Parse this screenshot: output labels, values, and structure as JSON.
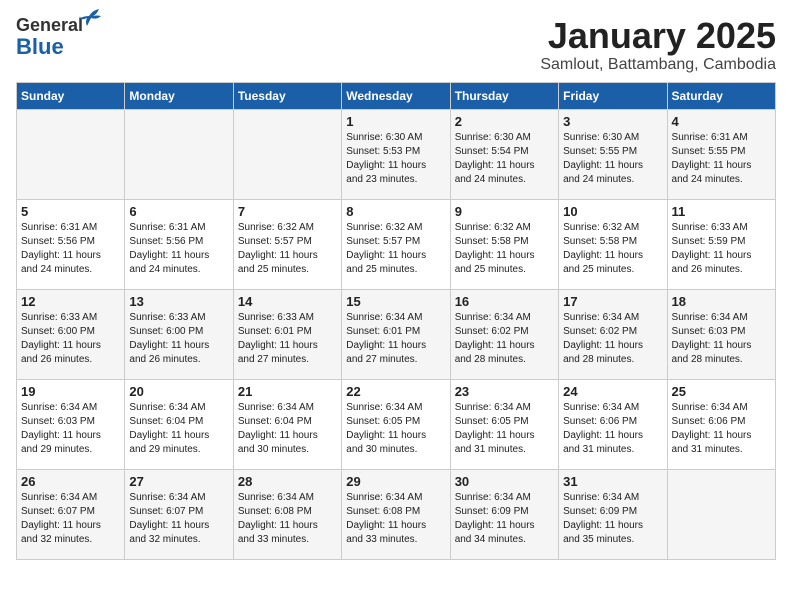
{
  "header": {
    "logo_general": "General",
    "logo_blue": "Blue",
    "title": "January 2025",
    "location": "Samlout, Battambang, Cambodia"
  },
  "weekdays": [
    "Sunday",
    "Monday",
    "Tuesday",
    "Wednesday",
    "Thursday",
    "Friday",
    "Saturday"
  ],
  "weeks": [
    [
      {
        "day": "",
        "info": ""
      },
      {
        "day": "",
        "info": ""
      },
      {
        "day": "",
        "info": ""
      },
      {
        "day": "1",
        "info": "Sunrise: 6:30 AM\nSunset: 5:53 PM\nDaylight: 11 hours\nand 23 minutes."
      },
      {
        "day": "2",
        "info": "Sunrise: 6:30 AM\nSunset: 5:54 PM\nDaylight: 11 hours\nand 24 minutes."
      },
      {
        "day": "3",
        "info": "Sunrise: 6:30 AM\nSunset: 5:55 PM\nDaylight: 11 hours\nand 24 minutes."
      },
      {
        "day": "4",
        "info": "Sunrise: 6:31 AM\nSunset: 5:55 PM\nDaylight: 11 hours\nand 24 minutes."
      }
    ],
    [
      {
        "day": "5",
        "info": "Sunrise: 6:31 AM\nSunset: 5:56 PM\nDaylight: 11 hours\nand 24 minutes."
      },
      {
        "day": "6",
        "info": "Sunrise: 6:31 AM\nSunset: 5:56 PM\nDaylight: 11 hours\nand 24 minutes."
      },
      {
        "day": "7",
        "info": "Sunrise: 6:32 AM\nSunset: 5:57 PM\nDaylight: 11 hours\nand 25 minutes."
      },
      {
        "day": "8",
        "info": "Sunrise: 6:32 AM\nSunset: 5:57 PM\nDaylight: 11 hours\nand 25 minutes."
      },
      {
        "day": "9",
        "info": "Sunrise: 6:32 AM\nSunset: 5:58 PM\nDaylight: 11 hours\nand 25 minutes."
      },
      {
        "day": "10",
        "info": "Sunrise: 6:32 AM\nSunset: 5:58 PM\nDaylight: 11 hours\nand 25 minutes."
      },
      {
        "day": "11",
        "info": "Sunrise: 6:33 AM\nSunset: 5:59 PM\nDaylight: 11 hours\nand 26 minutes."
      }
    ],
    [
      {
        "day": "12",
        "info": "Sunrise: 6:33 AM\nSunset: 6:00 PM\nDaylight: 11 hours\nand 26 minutes."
      },
      {
        "day": "13",
        "info": "Sunrise: 6:33 AM\nSunset: 6:00 PM\nDaylight: 11 hours\nand 26 minutes."
      },
      {
        "day": "14",
        "info": "Sunrise: 6:33 AM\nSunset: 6:01 PM\nDaylight: 11 hours\nand 27 minutes."
      },
      {
        "day": "15",
        "info": "Sunrise: 6:34 AM\nSunset: 6:01 PM\nDaylight: 11 hours\nand 27 minutes."
      },
      {
        "day": "16",
        "info": "Sunrise: 6:34 AM\nSunset: 6:02 PM\nDaylight: 11 hours\nand 28 minutes."
      },
      {
        "day": "17",
        "info": "Sunrise: 6:34 AM\nSunset: 6:02 PM\nDaylight: 11 hours\nand 28 minutes."
      },
      {
        "day": "18",
        "info": "Sunrise: 6:34 AM\nSunset: 6:03 PM\nDaylight: 11 hours\nand 28 minutes."
      }
    ],
    [
      {
        "day": "19",
        "info": "Sunrise: 6:34 AM\nSunset: 6:03 PM\nDaylight: 11 hours\nand 29 minutes."
      },
      {
        "day": "20",
        "info": "Sunrise: 6:34 AM\nSunset: 6:04 PM\nDaylight: 11 hours\nand 29 minutes."
      },
      {
        "day": "21",
        "info": "Sunrise: 6:34 AM\nSunset: 6:04 PM\nDaylight: 11 hours\nand 30 minutes."
      },
      {
        "day": "22",
        "info": "Sunrise: 6:34 AM\nSunset: 6:05 PM\nDaylight: 11 hours\nand 30 minutes."
      },
      {
        "day": "23",
        "info": "Sunrise: 6:34 AM\nSunset: 6:05 PM\nDaylight: 11 hours\nand 31 minutes."
      },
      {
        "day": "24",
        "info": "Sunrise: 6:34 AM\nSunset: 6:06 PM\nDaylight: 11 hours\nand 31 minutes."
      },
      {
        "day": "25",
        "info": "Sunrise: 6:34 AM\nSunset: 6:06 PM\nDaylight: 11 hours\nand 31 minutes."
      }
    ],
    [
      {
        "day": "26",
        "info": "Sunrise: 6:34 AM\nSunset: 6:07 PM\nDaylight: 11 hours\nand 32 minutes."
      },
      {
        "day": "27",
        "info": "Sunrise: 6:34 AM\nSunset: 6:07 PM\nDaylight: 11 hours\nand 32 minutes."
      },
      {
        "day": "28",
        "info": "Sunrise: 6:34 AM\nSunset: 6:08 PM\nDaylight: 11 hours\nand 33 minutes."
      },
      {
        "day": "29",
        "info": "Sunrise: 6:34 AM\nSunset: 6:08 PM\nDaylight: 11 hours\nand 33 minutes."
      },
      {
        "day": "30",
        "info": "Sunrise: 6:34 AM\nSunset: 6:09 PM\nDaylight: 11 hours\nand 34 minutes."
      },
      {
        "day": "31",
        "info": "Sunrise: 6:34 AM\nSunset: 6:09 PM\nDaylight: 11 hours\nand 35 minutes."
      },
      {
        "day": "",
        "info": ""
      }
    ]
  ]
}
